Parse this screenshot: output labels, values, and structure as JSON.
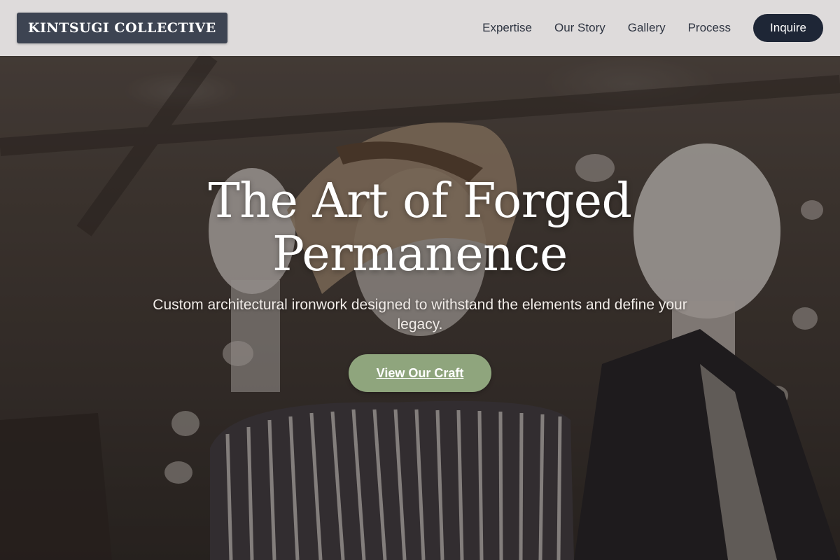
{
  "brand": {
    "name": "KINTSUGI COLLECTIVE"
  },
  "nav": {
    "items": [
      {
        "label": "Expertise"
      },
      {
        "label": "Our Story"
      },
      {
        "label": "Gallery"
      },
      {
        "label": "Process"
      }
    ],
    "cta_label": "Inquire"
  },
  "hero": {
    "title_line1": "The Art of Forged",
    "title_line2": "Permanence",
    "subtitle": "Custom architectural ironwork designed to withstand the elements and define your legacy.",
    "button_label": "View Our Craft",
    "background_image": "mannequins-boutique-photo"
  },
  "colors": {
    "header_bg": "#e8e6e6",
    "logo_bg": "#3d4452",
    "nav_text": "#2f3542",
    "cta_bg": "#1e2636",
    "hero_button_bg": "#8fa57d",
    "hero_text": "#ffffff"
  }
}
